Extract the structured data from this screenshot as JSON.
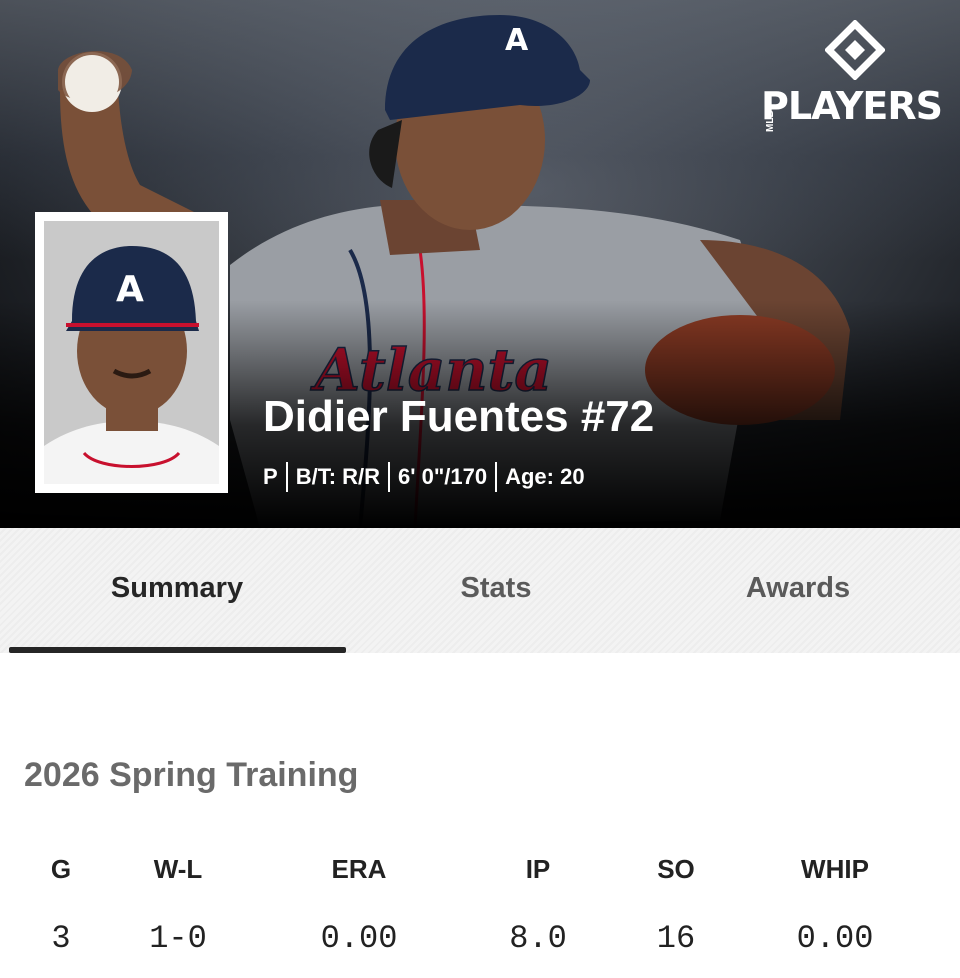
{
  "brand": {
    "logo_word": "PLAYERS",
    "logo_prefix": "MLB",
    "logo_icon": "diamond-logo-icon"
  },
  "player": {
    "name": "Didier Fuentes #72",
    "position": "P",
    "bats_throws": "B/T: R/R",
    "height_weight": "6' 0\"/170",
    "age": "Age: 20",
    "cap_letter": "A"
  },
  "colors": {
    "navy": "#1b2a4a",
    "red": "#c8102e",
    "jersey_gray": "#9a9ea4",
    "tab_active": "#262626"
  },
  "tabs": [
    {
      "label": "Summary",
      "active": true
    },
    {
      "label": "Stats",
      "active": false
    },
    {
      "label": "Awards",
      "active": false
    }
  ],
  "summary": {
    "section_title": "2026 Spring Training",
    "columns": [
      "G",
      "W-L",
      "ERA",
      "IP",
      "SO",
      "WHIP"
    ],
    "values": [
      "3",
      "1-0",
      "0.00",
      "8.0",
      "16",
      "0.00"
    ]
  }
}
